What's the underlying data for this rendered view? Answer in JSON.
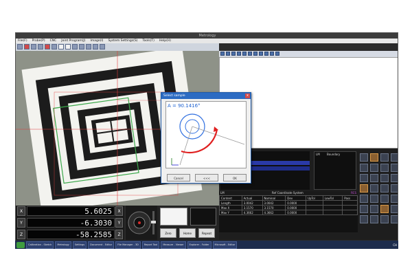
{
  "window": {
    "title": "Metrology"
  },
  "menu": [
    "File(F)",
    "Probe(P)",
    "CNC",
    "Joint Program(J)",
    "Image(I)",
    "System Settings(S)",
    "Tools(T)",
    "Help(H)"
  ],
  "readout": {
    "x": {
      "label": "X",
      "value": "5.6025",
      "button": "X"
    },
    "y": {
      "label": "Y",
      "value": "-6.3030",
      "button": "Y"
    },
    "z": {
      "label": "Z",
      "value": "-58.2585",
      "button": "Z"
    }
  },
  "small_panel": {
    "buttons": [
      "Zero",
      "Home",
      "Repeat"
    ]
  },
  "dialog": {
    "title": "Select sample",
    "close": "x",
    "angle_text": "A = 90.1416°",
    "buttons": [
      "Cancel",
      "<<<",
      "OK"
    ]
  },
  "lm_panel": {
    "header": "LM",
    "title": "Ref Coordinate System",
    "ref": "RCS",
    "columns": [
      "Content",
      "Actual",
      "Nominal",
      "Dev",
      "UpTol",
      "LowTol",
      "Pass"
    ],
    "rows": [
      {
        "name": "Length",
        "actual": "3.0042",
        "nominal": "3.0042",
        "dev": "0.0000"
      },
      {
        "name": "Max X",
        "actual": "3.1570",
        "nominal": "3.1570",
        "dev": "0.0000"
      },
      {
        "name": "Max Y",
        "actual": "4.3662",
        "nominal": "4.3662",
        "dev": "0.0000"
      }
    ]
  },
  "list_panel": {
    "col1": "LM",
    "col2": "Boundary"
  },
  "taskbar": {
    "items": [
      "",
      "Calibration - Sketch",
      "Metrology",
      "Settings",
      "Document - Editor",
      "File Manager - 3D",
      "Report Tool",
      "Measure - Viewer",
      "Explorer - Folder",
      "Microsoft - Editor"
    ],
    "tray": "CH"
  },
  "colors": {
    "accent": "#2c6bc2",
    "crosshair": "#e23b3b",
    "measure_arc": "#e02020",
    "circle_blue": "#2f6fe0"
  }
}
